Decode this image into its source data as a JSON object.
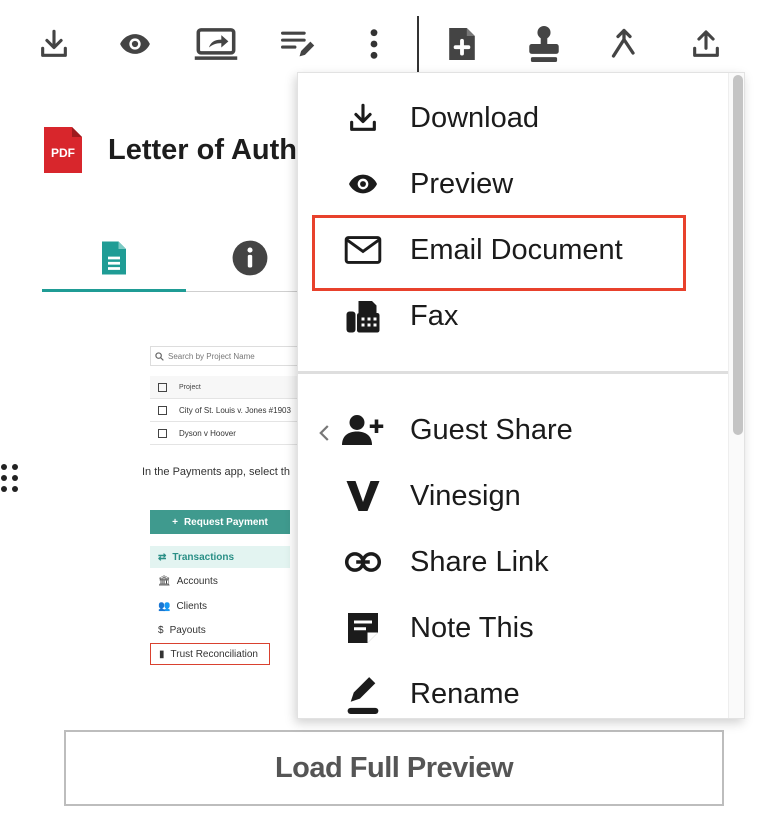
{
  "toolbar": {
    "items": [
      {
        "name": "download",
        "icon": "download-icon"
      },
      {
        "name": "preview",
        "icon": "eye-icon"
      },
      {
        "name": "present",
        "icon": "screen-share-icon"
      },
      {
        "name": "edit-text",
        "icon": "text-edit-icon"
      },
      {
        "name": "more",
        "icon": "more-vertical-icon"
      },
      {
        "name": "add-document",
        "icon": "file-plus-icon"
      },
      {
        "name": "stamp",
        "icon": "stamp-icon"
      },
      {
        "name": "merge",
        "icon": "merge-icon"
      },
      {
        "name": "upload",
        "icon": "upload-icon"
      }
    ]
  },
  "document": {
    "badge": "PDF",
    "title": "Letter of Auth"
  },
  "tabs": [
    {
      "name": "content",
      "icon": "document-icon",
      "active": true
    },
    {
      "name": "info",
      "icon": "info-icon",
      "active": false
    }
  ],
  "preview": {
    "search_placeholder": "Search by Project Name",
    "table_header": "Project",
    "rows": [
      "City of St. Louis v. Jones #1903",
      "Dyson v Hoover"
    ],
    "instruction": "In the Payments app, select th",
    "request_payment": "Request Payment",
    "nav": [
      {
        "label": "Transactions",
        "icon": "arrows-icon",
        "active": true
      },
      {
        "label": "Accounts",
        "icon": "bank-icon",
        "active": false
      },
      {
        "label": "Clients",
        "icon": "people-icon",
        "active": false
      },
      {
        "label": "Payouts",
        "icon": "dollar-circle-icon",
        "active": false
      },
      {
        "label": "Trust Reconciliation",
        "icon": "file-icon",
        "active": false,
        "highlighted": true
      }
    ]
  },
  "load_button": "Load Full Preview",
  "menu": {
    "group1": [
      {
        "label": "Download",
        "icon": "download-icon"
      },
      {
        "label": "Preview",
        "icon": "eye-icon"
      },
      {
        "label": "Email Document",
        "icon": "mail-icon",
        "highlighted": true
      },
      {
        "label": "Fax",
        "icon": "fax-icon"
      }
    ],
    "group2": [
      {
        "label": "Guest Share",
        "icon": "add-user-icon",
        "has_submenu": true
      },
      {
        "label": "Vinesign",
        "icon": "vinesign-icon"
      },
      {
        "label": "Share Link",
        "icon": "link-icon"
      },
      {
        "label": "Note This",
        "icon": "note-icon"
      },
      {
        "label": "Rename",
        "icon": "pencil-icon"
      }
    ]
  },
  "colors": {
    "accent": "#1f9c95",
    "highlight": "#e8412c",
    "pdf_red": "#d8262c"
  }
}
